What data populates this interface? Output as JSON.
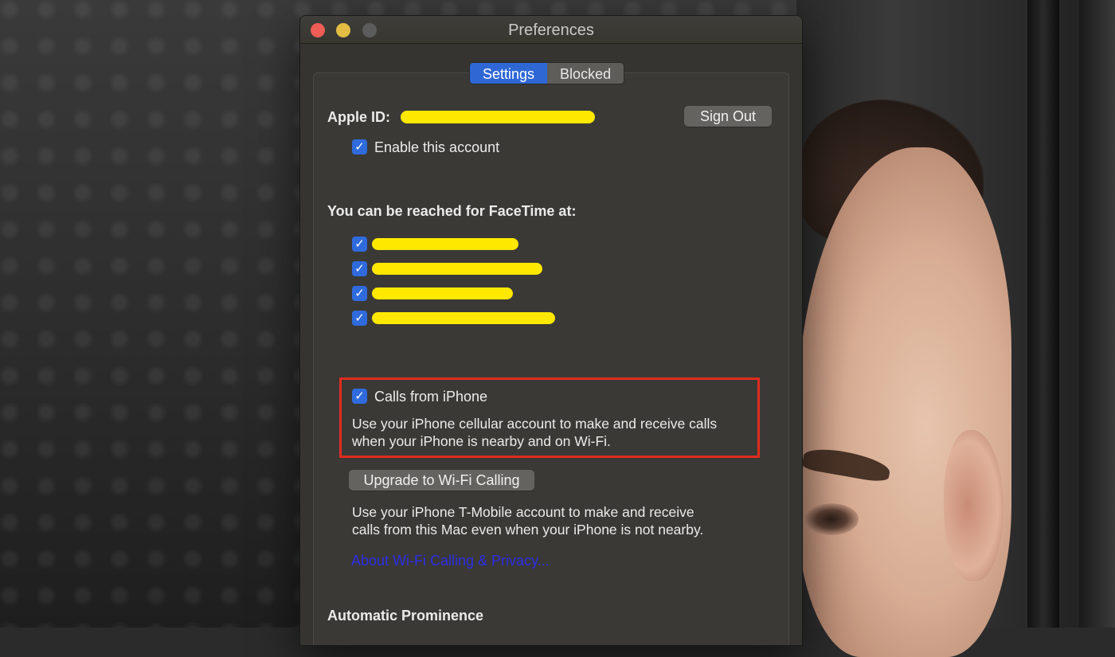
{
  "window": {
    "title": "Preferences"
  },
  "tabs": [
    {
      "label": "Settings",
      "active": true
    },
    {
      "label": "Blocked",
      "active": false
    }
  ],
  "account": {
    "apple_id_label": "Apple ID:",
    "sign_out_label": "Sign Out",
    "enable_label": "Enable this account",
    "enable_checked": true
  },
  "reach": {
    "heading": "You can be reached for FaceTime at:",
    "addresses_redacted": 4
  },
  "calls": {
    "label": "Calls from iPhone",
    "checked": true,
    "description_line1": "Use your iPhone cellular account to make and receive calls",
    "description_line2": "when your iPhone is nearby and on Wi-Fi."
  },
  "wifi": {
    "upgrade_label": "Upgrade to Wi-Fi Calling",
    "description_line1": "Use your iPhone T-Mobile account to make and receive",
    "description_line2": "calls from this Mac even when your iPhone is not nearby.",
    "link_label": "About Wi-Fi Calling & Privacy..."
  },
  "prominence": {
    "heading": "Automatic Prominence"
  },
  "colors": {
    "accent": "#2f67d5",
    "highlight_border": "#e02b1d",
    "redaction": "#ffe800",
    "link": "#2d2de6"
  }
}
